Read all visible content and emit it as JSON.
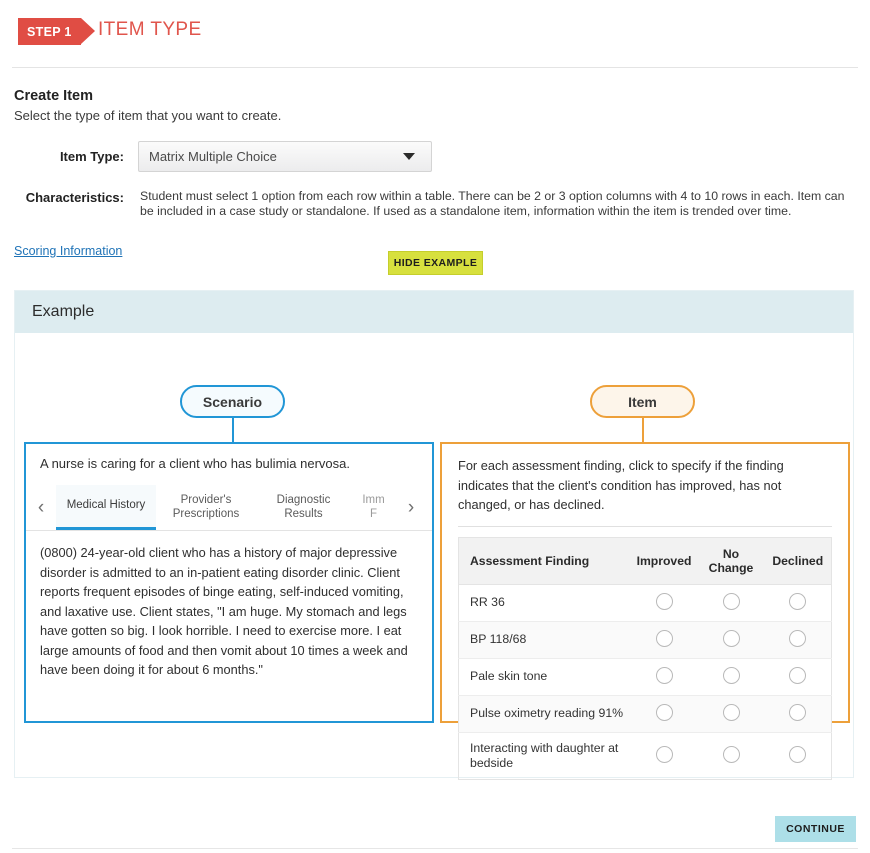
{
  "step": {
    "badge": "STEP 1",
    "title": "ITEM TYPE",
    "badge_color": "#e04d44",
    "title_color": "#e0554c"
  },
  "create": {
    "heading": "Create Item",
    "subheading": "Select the type of item that you want to create."
  },
  "form": {
    "item_type_label": "Item Type:",
    "item_type_value": "Matrix Multiple Choice",
    "characteristics_label": "Characteristics:",
    "characteristics_text": "Student must select 1 option from each row within a table. There can be 2 or 3 option columns with 4 to 10 rows in each. Item can be included in a case study or standalone. If used as a standalone item, information within the item is trended over time.",
    "scoring_link": "Scoring Information",
    "hide_example_label": "HIDE EXAMPLE",
    "hide_example_color": "#d7e03e"
  },
  "example": {
    "header": "Example",
    "header_bg": "#ddecf0",
    "scenario": {
      "pill_label": "Scenario",
      "pill_color": "#2196d6",
      "stem": "A nurse is caring for a client who has bulimia nervosa.",
      "prev_arrow": "‹",
      "next_arrow": "›",
      "tabs": [
        {
          "label": "Medical History",
          "active": true
        },
        {
          "label": "Provider's Prescriptions",
          "active": false
        },
        {
          "label": "Diagnostic Results",
          "active": false
        },
        {
          "label": "Imm F",
          "active": false
        }
      ],
      "body": "(0800) 24-year-old client who has a history of major depressive disorder is admitted to an in-patient eating disorder clinic. Client reports frequent episodes of binge eating, self-induced vomiting, and laxative use. Client states, \"I am huge. My stomach and legs have gotten so big. I look horrible. I need to exercise more. I eat large amounts of food and then vomit about 10 times a week and have been doing it for about 6 months.\""
    },
    "item": {
      "pill_label": "Item",
      "pill_color": "#eda03a",
      "stem": "For each assessment finding, click to specify if the finding indicates that the client's condition has improved, has not changed, or has declined.",
      "table": {
        "headers": [
          "Assessment Finding",
          "Improved",
          "No Change",
          "Declined"
        ],
        "rows": [
          "RR 36",
          "BP 118/68",
          "Pale skin tone",
          "Pulse oximetry reading 91%",
          "Interacting with daughter at bedside"
        ]
      }
    }
  },
  "footer": {
    "continue_label": "CONTINUE",
    "continue_color": "#addfe8"
  }
}
